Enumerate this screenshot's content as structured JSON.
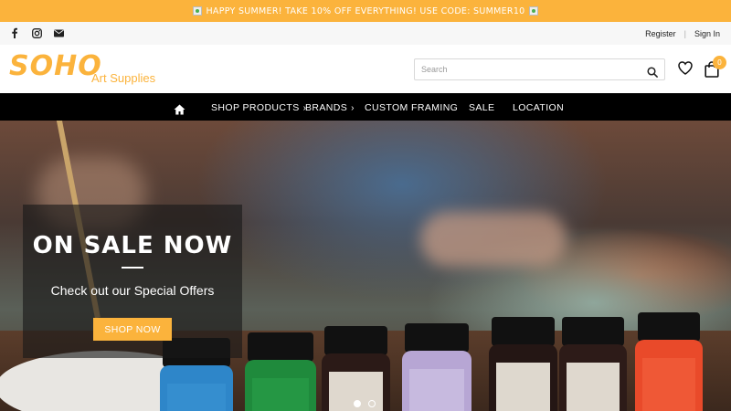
{
  "promo_bar": {
    "text": "HAPPY SUMMER! TAKE 10% OFF EVERYTHING! USE CODE: SUMMER10"
  },
  "social": {
    "items": [
      "facebook-icon",
      "instagram-icon",
      "envelope-icon"
    ]
  },
  "account": {
    "register": "Register",
    "sign_in": "Sign In",
    "separator": "|"
  },
  "logo": {
    "main": "SOHO",
    "sub": "Art Supplies"
  },
  "search": {
    "placeholder": "Search"
  },
  "cart": {
    "count": "0"
  },
  "nav": {
    "items": [
      {
        "label": "SHOP PRODUCTS",
        "has_submenu": true
      },
      {
        "label": "BRANDS",
        "has_submenu": true
      },
      {
        "label": "CUSTOM FRAMING",
        "has_submenu": false
      },
      {
        "label": "SALE",
        "has_submenu": false
      },
      {
        "label": "LOCATION",
        "has_submenu": false
      }
    ]
  },
  "hero": {
    "headline": "ON SALE NOW",
    "subheadline": "Check out our Special Offers",
    "cta": "SHOP NOW",
    "slide_count": 2,
    "active_slide": 1
  },
  "colors": {
    "accent": "#fbb33c",
    "nav_bg": "#000000"
  }
}
